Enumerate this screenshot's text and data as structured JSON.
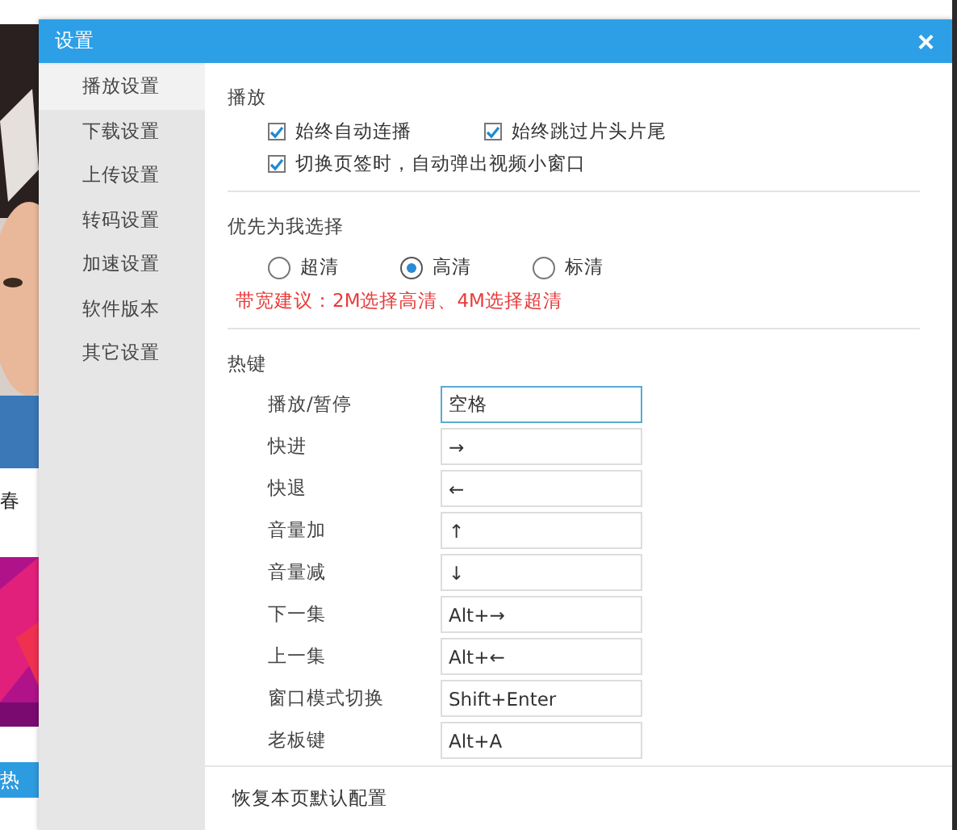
{
  "background": {
    "caption": "春",
    "banner": "热"
  },
  "window": {
    "title": "设置",
    "close": "×"
  },
  "sidebar": {
    "items": [
      {
        "label": "播放设置",
        "selected": true
      },
      {
        "label": "下载设置",
        "selected": false
      },
      {
        "label": "上传设置",
        "selected": false
      },
      {
        "label": "转码设置",
        "selected": false
      },
      {
        "label": "加速设置",
        "selected": false
      },
      {
        "label": "软件版本",
        "selected": false
      },
      {
        "label": "其它设置",
        "selected": false
      }
    ]
  },
  "playback": {
    "title": "播放",
    "options": [
      {
        "label": "始终自动连播",
        "checked": true
      },
      {
        "label": "始终跳过片头片尾",
        "checked": true
      },
      {
        "label": "切换页签时，自动弹出视频小窗口",
        "checked": true
      }
    ]
  },
  "quality": {
    "title": "优先为我选择",
    "options": [
      {
        "label": "超清",
        "selected": false
      },
      {
        "label": "高清",
        "selected": true
      },
      {
        "label": "标清",
        "selected": false
      }
    ],
    "note": "带宽建议：2M选择高清、4M选择超清"
  },
  "hotkeys": {
    "title": "热键",
    "rows": [
      {
        "label": "播放/暂停",
        "value": "空格",
        "focused": true
      },
      {
        "label": "快进",
        "value": "→",
        "focused": false
      },
      {
        "label": "快退",
        "value": "←",
        "focused": false
      },
      {
        "label": "音量加",
        "value": "↑",
        "focused": false
      },
      {
        "label": "音量减",
        "value": "↓",
        "focused": false
      },
      {
        "label": "下一集",
        "value": "Alt+→",
        "focused": false
      },
      {
        "label": "上一集",
        "value": "Alt+←",
        "focused": false
      },
      {
        "label": "窗口模式切换",
        "value": "Shift+Enter",
        "focused": false
      },
      {
        "label": "老板键",
        "value": "Alt+A",
        "focused": false
      }
    ]
  },
  "footer": {
    "reset": "恢复本页默认配置"
  }
}
